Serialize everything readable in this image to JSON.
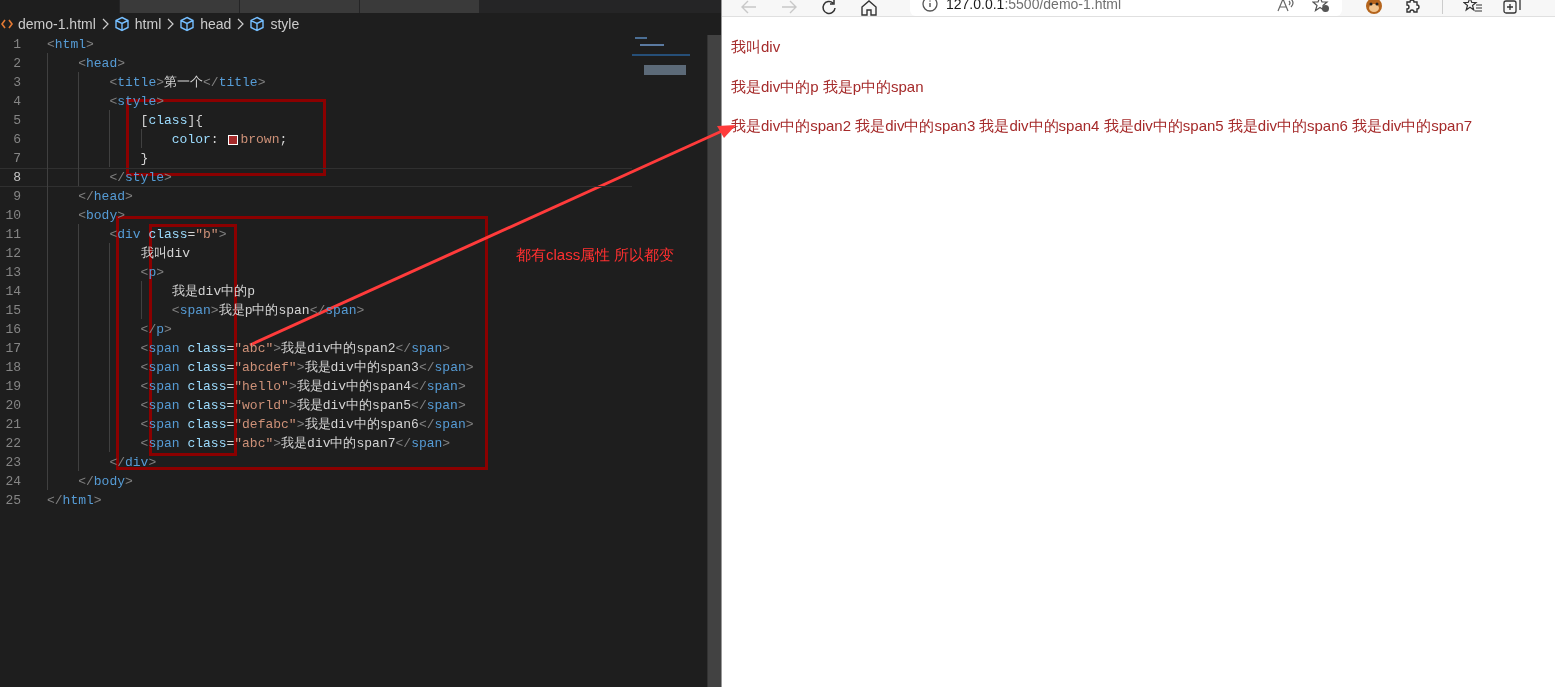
{
  "editor": {
    "tabs": [
      {
        "selected": true
      },
      {
        "selected": false
      },
      {
        "selected": false
      },
      {
        "selected": false
      }
    ],
    "breadcrumb": [
      {
        "kind": "file",
        "label": "demo-1.html"
      },
      {
        "kind": "element",
        "label": "html"
      },
      {
        "kind": "element",
        "label": "head"
      },
      {
        "kind": "element",
        "label": "style"
      }
    ],
    "lines": [
      {
        "number": "1",
        "current": false,
        "tokens": [
          {
            "kind": "punct",
            "text": "<"
          },
          {
            "kind": "tag",
            "text": "html"
          },
          {
            "kind": "punct",
            "text": ">"
          }
        ]
      },
      {
        "number": "2",
        "current": false,
        "tokens": [
          {
            "kind": "punct",
            "text": "    <"
          },
          {
            "kind": "tag",
            "text": "head"
          },
          {
            "kind": "punct",
            "text": ">"
          }
        ]
      },
      {
        "number": "3",
        "current": false,
        "tokens": [
          {
            "kind": "punct",
            "text": "        <"
          },
          {
            "kind": "tag",
            "text": "title"
          },
          {
            "kind": "punct",
            "text": ">"
          },
          {
            "kind": "text",
            "text": "第一个"
          },
          {
            "kind": "punct",
            "text": "</"
          },
          {
            "kind": "tag",
            "text": "title"
          },
          {
            "kind": "punct",
            "text": ">"
          }
        ]
      },
      {
        "number": "4",
        "current": false,
        "tokens": [
          {
            "kind": "punct",
            "text": "        <"
          },
          {
            "kind": "tag",
            "text": "style"
          },
          {
            "kind": "punct",
            "text": ">"
          }
        ]
      },
      {
        "number": "5",
        "current": false,
        "tokens": [
          {
            "kind": "text",
            "text": "            ["
          },
          {
            "kind": "attr",
            "text": "class"
          },
          {
            "kind": "text",
            "text": "]{"
          }
        ]
      },
      {
        "number": "6",
        "current": false,
        "tokens": [
          {
            "kind": "attr",
            "text": "                color"
          },
          {
            "kind": "text",
            "text": ": "
          },
          {
            "kind": "swatch",
            "color": "#a52a2a"
          },
          {
            "kind": "string",
            "text": "brown"
          },
          {
            "kind": "text",
            "text": ";"
          }
        ]
      },
      {
        "number": "7",
        "current": false,
        "tokens": [
          {
            "kind": "text",
            "text": "            }"
          }
        ]
      },
      {
        "number": "8",
        "current": true,
        "tokens": [
          {
            "kind": "punct",
            "text": "        </"
          },
          {
            "kind": "tag",
            "text": "style"
          },
          {
            "kind": "punct",
            "text": ">"
          }
        ]
      },
      {
        "number": "9",
        "current": false,
        "tokens": [
          {
            "kind": "punct",
            "text": "    </"
          },
          {
            "kind": "tag",
            "text": "head"
          },
          {
            "kind": "punct",
            "text": ">"
          }
        ]
      },
      {
        "number": "10",
        "current": false,
        "tokens": [
          {
            "kind": "punct",
            "text": "    <"
          },
          {
            "kind": "tag",
            "text": "body"
          },
          {
            "kind": "punct",
            "text": ">"
          }
        ]
      },
      {
        "number": "11",
        "current": false,
        "tokens": [
          {
            "kind": "punct",
            "text": "        <"
          },
          {
            "kind": "tag",
            "text": "div"
          },
          {
            "kind": "attr",
            "text": " class"
          },
          {
            "kind": "text",
            "text": "="
          },
          {
            "kind": "string",
            "text": "\"b\""
          },
          {
            "kind": "punct",
            "text": ">"
          }
        ]
      },
      {
        "number": "12",
        "current": false,
        "tokens": [
          {
            "kind": "text",
            "text": "            我叫div"
          }
        ]
      },
      {
        "number": "13",
        "current": false,
        "tokens": [
          {
            "kind": "punct",
            "text": "            <"
          },
          {
            "kind": "tag",
            "text": "p"
          },
          {
            "kind": "punct",
            "text": ">"
          }
        ]
      },
      {
        "number": "14",
        "current": false,
        "tokens": [
          {
            "kind": "text",
            "text": "                我是div中的p"
          }
        ]
      },
      {
        "number": "15",
        "current": false,
        "tokens": [
          {
            "kind": "punct",
            "text": "                <"
          },
          {
            "kind": "tag",
            "text": "span"
          },
          {
            "kind": "punct",
            "text": ">"
          },
          {
            "kind": "text",
            "text": "我是p中的span"
          },
          {
            "kind": "punct",
            "text": "</"
          },
          {
            "kind": "tag",
            "text": "span"
          },
          {
            "kind": "punct",
            "text": ">"
          }
        ]
      },
      {
        "number": "16",
        "current": false,
        "tokens": [
          {
            "kind": "punct",
            "text": "            </"
          },
          {
            "kind": "tag",
            "text": "p"
          },
          {
            "kind": "punct",
            "text": ">"
          }
        ]
      },
      {
        "number": "17",
        "current": false,
        "tokens": [
          {
            "kind": "punct",
            "text": "            <"
          },
          {
            "kind": "tag",
            "text": "span"
          },
          {
            "kind": "attr",
            "text": " class"
          },
          {
            "kind": "text",
            "text": "="
          },
          {
            "kind": "string",
            "text": "\"abc\""
          },
          {
            "kind": "punct",
            "text": ">"
          },
          {
            "kind": "text",
            "text": "我是div中的span2"
          },
          {
            "kind": "punct",
            "text": "</"
          },
          {
            "kind": "tag",
            "text": "span"
          },
          {
            "kind": "punct",
            "text": ">"
          }
        ]
      },
      {
        "number": "18",
        "current": false,
        "tokens": [
          {
            "kind": "punct",
            "text": "            <"
          },
          {
            "kind": "tag",
            "text": "span"
          },
          {
            "kind": "attr",
            "text": " class"
          },
          {
            "kind": "text",
            "text": "="
          },
          {
            "kind": "string",
            "text": "\"abcdef\""
          },
          {
            "kind": "punct",
            "text": ">"
          },
          {
            "kind": "text",
            "text": "我是div中的span3"
          },
          {
            "kind": "punct",
            "text": "</"
          },
          {
            "kind": "tag",
            "text": "span"
          },
          {
            "kind": "punct",
            "text": ">"
          }
        ]
      },
      {
        "number": "19",
        "current": false,
        "tokens": [
          {
            "kind": "punct",
            "text": "            <"
          },
          {
            "kind": "tag",
            "text": "span"
          },
          {
            "kind": "attr",
            "text": " class"
          },
          {
            "kind": "text",
            "text": "="
          },
          {
            "kind": "string",
            "text": "\"hello\""
          },
          {
            "kind": "punct",
            "text": ">"
          },
          {
            "kind": "text",
            "text": "我是div中的span4"
          },
          {
            "kind": "punct",
            "text": "</"
          },
          {
            "kind": "tag",
            "text": "span"
          },
          {
            "kind": "punct",
            "text": ">"
          }
        ]
      },
      {
        "number": "20",
        "current": false,
        "tokens": [
          {
            "kind": "punct",
            "text": "            <"
          },
          {
            "kind": "tag",
            "text": "span"
          },
          {
            "kind": "attr",
            "text": " class"
          },
          {
            "kind": "text",
            "text": "="
          },
          {
            "kind": "string",
            "text": "\"world\""
          },
          {
            "kind": "punct",
            "text": ">"
          },
          {
            "kind": "text",
            "text": "我是div中的span5"
          },
          {
            "kind": "punct",
            "text": "</"
          },
          {
            "kind": "tag",
            "text": "span"
          },
          {
            "kind": "punct",
            "text": ">"
          }
        ]
      },
      {
        "number": "21",
        "current": false,
        "tokens": [
          {
            "kind": "punct",
            "text": "            <"
          },
          {
            "kind": "tag",
            "text": "span"
          },
          {
            "kind": "attr",
            "text": " class"
          },
          {
            "kind": "text",
            "text": "="
          },
          {
            "kind": "string",
            "text": "\"defabc\""
          },
          {
            "kind": "punct",
            "text": ">"
          },
          {
            "kind": "text",
            "text": "我是div中的span6"
          },
          {
            "kind": "punct",
            "text": "</"
          },
          {
            "kind": "tag",
            "text": "span"
          },
          {
            "kind": "punct",
            "text": ">"
          }
        ]
      },
      {
        "number": "22",
        "current": false,
        "tokens": [
          {
            "kind": "punct",
            "text": "            <"
          },
          {
            "kind": "tag",
            "text": "span"
          },
          {
            "kind": "attr",
            "text": " class"
          },
          {
            "kind": "text",
            "text": "="
          },
          {
            "kind": "string",
            "text": "\"abc\""
          },
          {
            "kind": "punct",
            "text": ">"
          },
          {
            "kind": "text",
            "text": "我是div中的span7"
          },
          {
            "kind": "punct",
            "text": "</"
          },
          {
            "kind": "tag",
            "text": "span"
          },
          {
            "kind": "punct",
            "text": ">"
          }
        ]
      },
      {
        "number": "23",
        "current": false,
        "tokens": [
          {
            "kind": "punct",
            "text": "        </"
          },
          {
            "kind": "tag",
            "text": "div"
          },
          {
            "kind": "punct",
            "text": ">"
          }
        ]
      },
      {
        "number": "24",
        "current": false,
        "tokens": [
          {
            "kind": "punct",
            "text": "    </"
          },
          {
            "kind": "tag",
            "text": "body"
          },
          {
            "kind": "punct",
            "text": ">"
          }
        ]
      },
      {
        "number": "25",
        "current": false,
        "tokens": [
          {
            "kind": "punct",
            "text": "</"
          },
          {
            "kind": "tag",
            "text": "html"
          },
          {
            "kind": "punct",
            "text": ">"
          }
        ]
      }
    ]
  },
  "annotation": {
    "note": "都有class属性 所以都变"
  },
  "browser": {
    "back_enabled": false,
    "forward_enabled": false,
    "address": {
      "host": "127.0.0.1",
      "rest": ":5500/demo-1.html"
    },
    "paragraphs": [
      "我叫div",
      "我是div中的p 我是p中的span",
      "我是div中的span2 我是div中的span3 我是div中的span4 我是div中的span5 我是div中的span6 我是div中的span7"
    ]
  }
}
